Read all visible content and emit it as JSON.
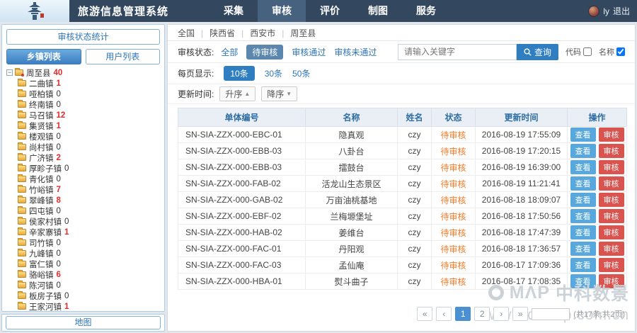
{
  "navbar": {
    "title": "旅游信息管理系统",
    "menu": [
      "采集",
      "审核",
      "评价",
      "制图",
      "服务"
    ],
    "user_name": "ly",
    "logout_label": "退出"
  },
  "sidebar": {
    "stats_button": "审核状态统计",
    "tab_towns": "乡镇列表",
    "tab_users": "用户列表",
    "county": {
      "name": "周至县",
      "count": "40"
    },
    "towns": [
      {
        "name": "二曲镇",
        "count": "1"
      },
      {
        "name": "哑柏镇",
        "count": "0"
      },
      {
        "name": "终南镇",
        "count": "0"
      },
      {
        "name": "马召镇",
        "count": "12"
      },
      {
        "name": "集贤镇",
        "count": "1"
      },
      {
        "name": "楼观镇",
        "count": "0"
      },
      {
        "name": "尚村镇",
        "count": "0"
      },
      {
        "name": "广济镇",
        "count": "2"
      },
      {
        "name": "厚畛子镇",
        "count": "0"
      },
      {
        "name": "青化镇",
        "count": "0"
      },
      {
        "name": "竹峪镇",
        "count": "7"
      },
      {
        "name": "翠峰镇",
        "count": "8"
      },
      {
        "name": "四屯镇",
        "count": "0"
      },
      {
        "name": "侯家村镇",
        "count": "0"
      },
      {
        "name": "辛家寨镇",
        "count": "1"
      },
      {
        "name": "司竹镇",
        "count": "0"
      },
      {
        "name": "九峰镇",
        "count": "0"
      },
      {
        "name": "富仁镇",
        "count": "0"
      },
      {
        "name": "骆峪镇",
        "count": "6"
      },
      {
        "name": "陈河镇",
        "count": "0"
      },
      {
        "name": "板房子镇",
        "count": "0"
      },
      {
        "name": "王家河镇",
        "count": "1"
      }
    ],
    "map_button": "地图"
  },
  "main": {
    "breadcrumb": {
      "items": [
        "全国",
        "陕西省",
        "西安市",
        "周至县"
      ]
    },
    "filter": {
      "status_label": "审核状态:",
      "opt_all": "全部",
      "opt_pending": "待审核",
      "opt_passed": "审核通过",
      "opt_failed": "审核未通过",
      "search_placeholder": "请输入关键字",
      "search_button": "查询",
      "code_label": "代码",
      "code_checked": false,
      "name_label": "名称",
      "name_checked": true
    },
    "page_size": {
      "label": "每页显示:",
      "options": [
        "10条",
        "30条",
        "50条"
      ]
    },
    "sort": {
      "label": "更新时间:",
      "asc": "升序",
      "desc": "降序",
      "asc_caret": "▲",
      "desc_caret": "▼"
    },
    "table": {
      "headers": [
        "单体编号",
        "名称",
        "姓名",
        "状态",
        "更新时间",
        "操作"
      ],
      "view_label": "查看",
      "review_label": "审核",
      "rows": [
        {
          "code": "SN-SIA-ZZX-000-EBC-01",
          "name": "隐真观",
          "user": "czy",
          "status": "待审核",
          "time": "2016-08-19 17:55:09"
        },
        {
          "code": "SN-SIA-ZZX-000-EBB-03",
          "name": "八卦台",
          "user": "czy",
          "status": "待审核",
          "time": "2016-08-19 17:20:15"
        },
        {
          "code": "SN-SIA-ZZX-000-EBB-03",
          "name": "擂鼓台",
          "user": "czy",
          "status": "待审核",
          "time": "2016-08-19 16:39:00"
        },
        {
          "code": "SN-SIA-ZZX-000-FAB-02",
          "name": "活龙山生态景区",
          "user": "czy",
          "status": "待审核",
          "time": "2016-08-19 11:21:41"
        },
        {
          "code": "SN-SIA-ZZX-000-GAB-02",
          "name": "万亩油桃基地",
          "user": "czy",
          "status": "待审核",
          "time": "2016-08-18 18:09:07"
        },
        {
          "code": "SN-SIA-ZZX-000-EBF-02",
          "name": "兰梅塬堡址",
          "user": "czy",
          "status": "待审核",
          "time": "2016-08-18 17:50:56"
        },
        {
          "code": "SN-SIA-ZZX-000-HAB-02",
          "name": "姜维台",
          "user": "czy",
          "status": "待审核",
          "time": "2016-08-18 17:47:39"
        },
        {
          "code": "SN-SIA-ZZX-000-FAC-01",
          "name": "丹阳观",
          "user": "czy",
          "status": "待审核",
          "time": "2016-08-18 17:36:57"
        },
        {
          "code": "SN-SIA-ZZX-000-FAC-03",
          "name": "孟仙庵",
          "user": "czy",
          "status": "待审核",
          "time": "2016-08-17 17:09:36"
        },
        {
          "code": "SN-SIA-ZZX-000-HBA-01",
          "name": "熨斗曲子",
          "user": "czy",
          "status": "待审核",
          "time": "2016-08-17 17:08:35"
        }
      ]
    },
    "pagination": {
      "first": "«",
      "prev": "‹",
      "pages": [
        "1",
        "2"
      ],
      "next": "›",
      "last": "»",
      "summary": "(共17条,共2页)"
    },
    "watermark": {
      "logo": "MΛP",
      "brand": "中科数景",
      "url": "www.dtmap.com.cn"
    }
  }
}
